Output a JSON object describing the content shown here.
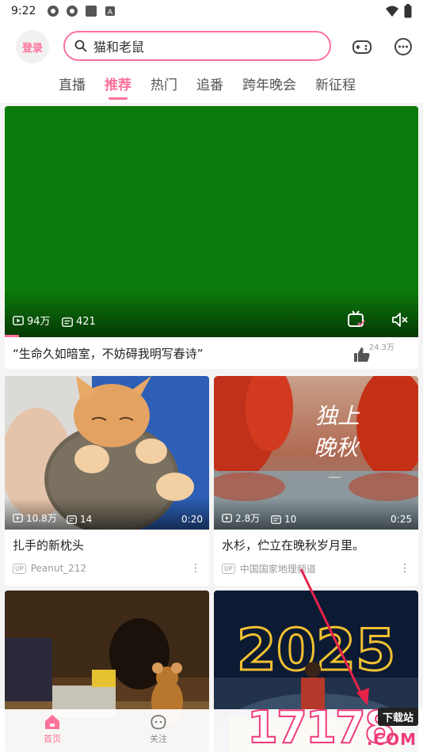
{
  "status_bar": {
    "time": "9:22"
  },
  "header": {
    "login_label": "登录",
    "search_value": "猫和老鼠"
  },
  "tabs": [
    "直播",
    "推荐",
    "热门",
    "追番",
    "跨年晚会",
    "新征程"
  ],
  "active_tab": "推荐",
  "featured": {
    "views": "94万",
    "danmaku": "421",
    "title": "“生命久如暗室，不妨碍我明写春诗”",
    "likes": "24.3万",
    "progress": 0.035
  },
  "cards": [
    {
      "views": "10.8万",
      "danmaku": "14",
      "duration": "0:20",
      "title": "扎手的新枕头",
      "up_badge": "UP",
      "author": "Peanut_212"
    },
    {
      "views": "2.8万",
      "danmaku": "10",
      "duration": "0:25",
      "title": "水杉，伫立在晚秋岁月里。",
      "up_badge": "UP",
      "author": "中国国家地理频道",
      "thumb_text": "独上晚秋"
    },
    {
      "thumb_text": "",
      "title": "",
      "author": ""
    },
    {
      "thumb_text": "2025"
    }
  ],
  "bottom_nav": [
    {
      "label": "首页",
      "icon": "home-icon",
      "active": true
    },
    {
      "label": "关注",
      "icon": "follow-icon",
      "active": false
    }
  ],
  "watermark": {
    "number": "17178",
    "site_label": "下载站",
    "domain": ".COM"
  },
  "colors": {
    "accent": "#fb7299",
    "featured_bg": "#0b7b0b"
  }
}
